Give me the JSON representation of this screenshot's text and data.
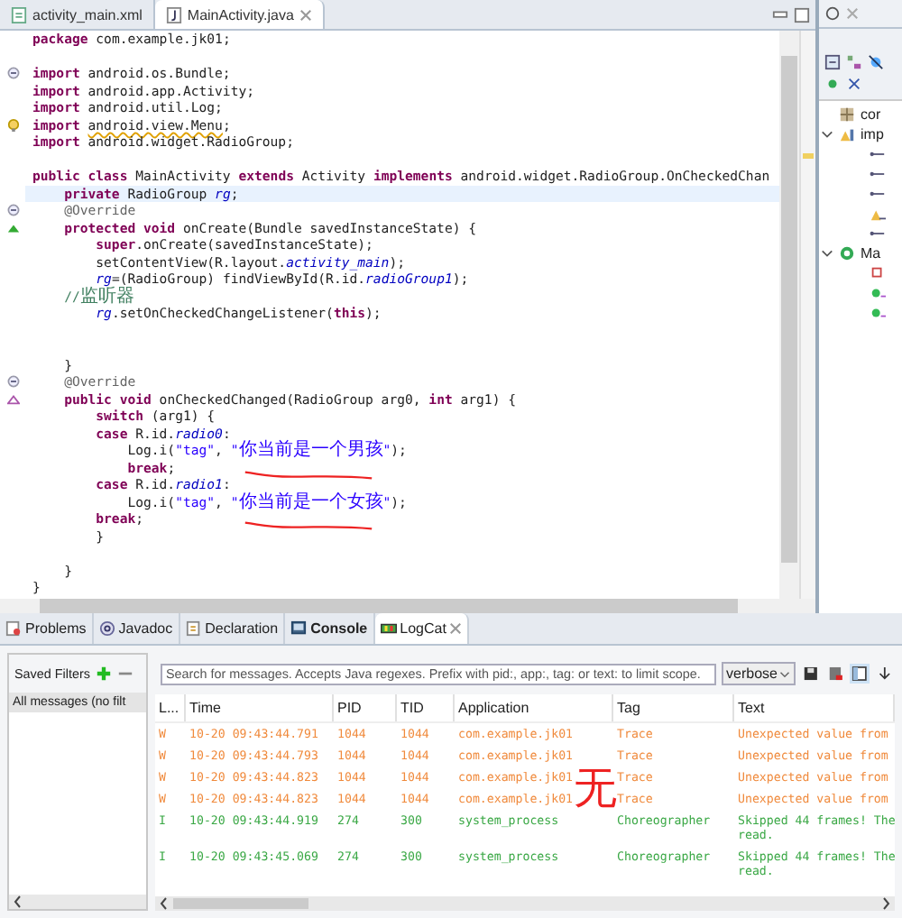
{
  "editor": {
    "tabs": [
      {
        "label": "activity_main.xml",
        "kind": "xml",
        "selected": false
      },
      {
        "label": "MainActivity.java",
        "kind": "java",
        "selected": true,
        "closable": true
      }
    ],
    "lines": [
      {
        "kind": "code",
        "tokens": [
          {
            "kind": "kw",
            "text": "package"
          },
          {
            "kind": "plain",
            "text": " com.example.jk01;"
          }
        ]
      },
      {
        "kind": "blank"
      },
      {
        "kind": "code",
        "gutter": {
          "kind": "fold"
        },
        "tokens": [
          {
            "kind": "kw",
            "text": "import"
          },
          {
            "kind": "plain",
            "text": " android.os.Bundle;"
          }
        ]
      },
      {
        "kind": "code",
        "tokens": [
          {
            "kind": "kw",
            "text": "import"
          },
          {
            "kind": "plain",
            "text": " android.app.Activity;"
          }
        ]
      },
      {
        "kind": "code",
        "tokens": [
          {
            "kind": "kw",
            "text": "import"
          },
          {
            "kind": "plain",
            "text": " android.util.Log;"
          }
        ]
      },
      {
        "kind": "code",
        "gutter": {
          "kind": "warning"
        },
        "tokens": [
          {
            "kind": "kw",
            "text": "import "
          },
          {
            "kind": "warn",
            "text": "android.view.Menu"
          },
          {
            "kind": "plain",
            "text": ";"
          }
        ]
      },
      {
        "kind": "code",
        "tokens": [
          {
            "kind": "kw",
            "text": "import"
          },
          {
            "kind": "plain",
            "text": " android.widget.RadioGroup;"
          }
        ]
      },
      {
        "kind": "blank"
      },
      {
        "kind": "code",
        "tokens": [
          {
            "kind": "kw",
            "text": "public class"
          },
          {
            "kind": "plain",
            "text": " MainActivity "
          },
          {
            "kind": "kw",
            "text": "extends"
          },
          {
            "kind": "plain",
            "text": " Activity "
          },
          {
            "kind": "kw",
            "text": "implements"
          },
          {
            "kind": "plain",
            "text": " android.widget.RadioGroup.OnCheckedChan"
          }
        ]
      },
      {
        "kind": "code",
        "current": true,
        "tokens": [
          {
            "kind": "kw",
            "text": "    private"
          },
          {
            "kind": "plain",
            "text": " RadioGroup "
          },
          {
            "kind": "field",
            "text": "rg"
          },
          {
            "kind": "plain",
            "text": ";"
          }
        ]
      },
      {
        "kind": "code",
        "gutter": {
          "kind": "fold"
        },
        "tokens": [
          {
            "kind": "ann",
            "text": "    @Override"
          }
        ]
      },
      {
        "kind": "code",
        "gutter": {
          "kind": "override"
        },
        "tokens": [
          {
            "kind": "kw",
            "text": "    protected void"
          },
          {
            "kind": "plain",
            "text": " onCreate(Bundle savedInstanceState) {"
          }
        ]
      },
      {
        "kind": "code",
        "tokens": [
          {
            "kind": "kw",
            "text": "        super"
          },
          {
            "kind": "plain",
            "text": ".onCreate(savedInstanceState);"
          }
        ]
      },
      {
        "kind": "code",
        "tokens": [
          {
            "kind": "plain",
            "text": "        setContentView(R.layout."
          },
          {
            "kind": "field",
            "text": "activity_main"
          },
          {
            "kind": "plain",
            "text": ");"
          }
        ]
      },
      {
        "kind": "code",
        "tokens": [
          {
            "kind": "field",
            "text": "        rg"
          },
          {
            "kind": "plain",
            "text": "=(RadioGroup) findViewById(R.id."
          },
          {
            "kind": "field",
            "text": "radioGroup1"
          },
          {
            "kind": "plain",
            "text": ");"
          }
        ]
      },
      {
        "kind": "code",
        "tokens": [
          {
            "kind": "comment",
            "text": "    //监听器"
          }
        ]
      },
      {
        "kind": "code",
        "tokens": [
          {
            "kind": "field",
            "text": "        rg"
          },
          {
            "kind": "plain",
            "text": ".setOnCheckedChangeListener("
          },
          {
            "kind": "kw",
            "text": "this"
          },
          {
            "kind": "plain",
            "text": ");"
          }
        ]
      },
      {
        "kind": "blank"
      },
      {
        "kind": "blank"
      },
      {
        "kind": "code",
        "tokens": [
          {
            "kind": "plain",
            "text": "    }"
          }
        ]
      },
      {
        "kind": "code",
        "gutter": {
          "kind": "fold"
        },
        "tokens": [
          {
            "kind": "ann",
            "text": "    @Override"
          }
        ]
      },
      {
        "kind": "code",
        "gutter": {
          "kind": "implements"
        },
        "tokens": [
          {
            "kind": "kw",
            "text": "    public void"
          },
          {
            "kind": "plain",
            "text": " onCheckedChanged(RadioGroup arg0, "
          },
          {
            "kind": "kw",
            "text": "int"
          },
          {
            "kind": "plain",
            "text": " arg1) {"
          }
        ]
      },
      {
        "kind": "code",
        "tokens": [
          {
            "kind": "kw",
            "text": "        switch"
          },
          {
            "kind": "plain",
            "text": " (arg1) {"
          }
        ]
      },
      {
        "kind": "code",
        "tokens": [
          {
            "kind": "kw",
            "text": "        case"
          },
          {
            "kind": "plain",
            "text": " R.id."
          },
          {
            "kind": "field",
            "text": "radio0"
          },
          {
            "kind": "plain",
            "text": ":"
          }
        ]
      },
      {
        "kind": "code",
        "tokens": [
          {
            "kind": "plain",
            "text": "            Log.i("
          },
          {
            "kind": "str",
            "text": "\"tag\""
          },
          {
            "kind": "plain",
            "text": ", "
          },
          {
            "kind": "str",
            "text": "\"你当前是一个男孩\""
          },
          {
            "kind": "plain",
            "text": ");"
          }
        ]
      },
      {
        "kind": "code",
        "scribble": true,
        "tokens": [
          {
            "kind": "kw",
            "text": "            break"
          },
          {
            "kind": "plain",
            "text": ";"
          }
        ]
      },
      {
        "kind": "code",
        "tokens": [
          {
            "kind": "kw",
            "text": "        case"
          },
          {
            "kind": "plain",
            "text": " R.id."
          },
          {
            "kind": "field",
            "text": "radio1"
          },
          {
            "kind": "plain",
            "text": ":"
          }
        ]
      },
      {
        "kind": "code",
        "tokens": [
          {
            "kind": "plain",
            "text": "            Log.i("
          },
          {
            "kind": "str",
            "text": "\"tag\""
          },
          {
            "kind": "plain",
            "text": ", "
          },
          {
            "kind": "str",
            "text": "\"你当前是一个女孩\""
          },
          {
            "kind": "plain",
            "text": ");"
          }
        ]
      },
      {
        "kind": "code",
        "scribble": true,
        "tokens": [
          {
            "kind": "kw",
            "text": "        break"
          },
          {
            "kind": "plain",
            "text": ";"
          }
        ]
      },
      {
        "kind": "code",
        "tokens": [
          {
            "kind": "plain",
            "text": "        }"
          }
        ]
      },
      {
        "kind": "blank"
      },
      {
        "kind": "code",
        "tokens": [
          {
            "kind": "plain",
            "text": "    }"
          }
        ]
      },
      {
        "kind": "code",
        "tokens": [
          {
            "kind": "plain",
            "text": "}"
          }
        ]
      }
    ]
  },
  "outline": {
    "items": [
      {
        "label": "cor",
        "kind": "package"
      },
      {
        "label": "imp",
        "kind": "imports",
        "expanded": true,
        "children": [
          {
            "kind": "import"
          },
          {
            "kind": "import"
          },
          {
            "kind": "import"
          },
          {
            "kind": "warning"
          },
          {
            "kind": "import"
          }
        ]
      },
      {
        "label": "Ma",
        "kind": "class",
        "expanded": true,
        "children": [
          {
            "kind": "field"
          },
          {
            "kind": "method"
          },
          {
            "kind": "method"
          }
        ]
      }
    ]
  },
  "bottom_tabs": [
    {
      "label": "Problems",
      "kind": "problems",
      "selected": false
    },
    {
      "label": "Javadoc",
      "kind": "javadoc",
      "selected": false
    },
    {
      "label": "Declaration",
      "kind": "declaration",
      "selected": false
    },
    {
      "label": "Console",
      "kind": "console",
      "selected": false
    },
    {
      "label": "LogCat",
      "kind": "logcat",
      "selected": true,
      "closable": true
    }
  ],
  "saved_filters": {
    "title": "Saved Filters",
    "items": [
      {
        "label": "All messages (no filt",
        "selected": true
      }
    ]
  },
  "logcat": {
    "search": {
      "placeholder": "Search for messages. Accepts Java regexes. Prefix with pid:, app:, tag: or text: to limit scope."
    },
    "log_level": "verbose",
    "columns": [
      "L...",
      "Time",
      "PID",
      "TID",
      "Application",
      "Tag",
      "Text"
    ],
    "rows": [
      {
        "kind": "warning",
        "cells": [
          "W",
          "10-20 09:43:44.791",
          "1044",
          "1044",
          "com.example.jk01",
          "Trace"
        ],
        "text_lines": [
          "Unexpected value from"
        ]
      },
      {
        "kind": "warning",
        "cells": [
          "W",
          "10-20 09:43:44.793",
          "1044",
          "1044",
          "com.example.jk01",
          "Trace"
        ],
        "text_lines": [
          "Unexpected value from"
        ]
      },
      {
        "kind": "warning",
        "cells": [
          "W",
          "10-20 09:43:44.823",
          "1044",
          "1044",
          "com.example.jk01",
          "Trace"
        ],
        "text_lines": [
          "Unexpected value from"
        ]
      },
      {
        "kind": "warning",
        "cells": [
          "W",
          "10-20 09:43:44.823",
          "1044",
          "1044",
          "com.example.jk01",
          "Trace"
        ],
        "text_lines": [
          "Unexpected value from"
        ]
      },
      {
        "kind": "info",
        "cells": [
          "I",
          "10-20 09:43:44.919",
          "274",
          "300",
          "system_process",
          "Choreographer"
        ],
        "text_lines": [
          "Skipped 44 frames!  The",
          "read."
        ]
      },
      {
        "kind": "info",
        "cells": [
          "I",
          "10-20 09:43:45.069",
          "274",
          "300",
          "system_process",
          "Choreographer"
        ],
        "text_lines": [
          "Skipped 44 frames!  The",
          "read."
        ]
      }
    ],
    "handwritten_note": "无"
  }
}
